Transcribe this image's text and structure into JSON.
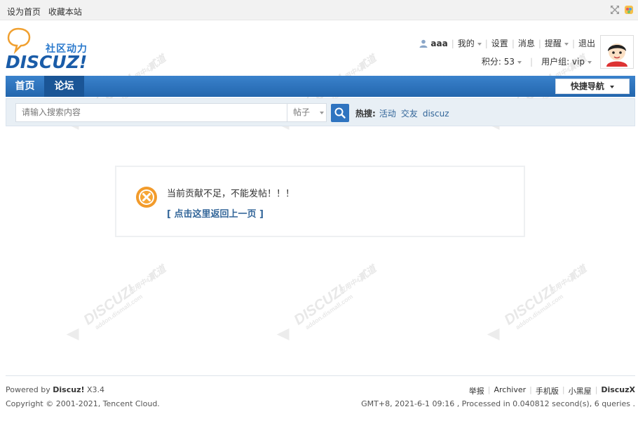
{
  "topbar": {
    "set_home": "设为首页",
    "bookmark": "收藏本站"
  },
  "logo": {
    "slogan": "社区动力",
    "word": "DISCUZ!"
  },
  "user_nav": {
    "username": "aaa",
    "my": "我的",
    "settings": "设置",
    "messages": "消息",
    "reminders": "提醒",
    "logout": "退出"
  },
  "user_info": {
    "points_label": "积分: 53",
    "group_label": "用户组: vip"
  },
  "nav": {
    "home": "首页",
    "forum": "论坛",
    "quick_nav": "快捷导航"
  },
  "search": {
    "placeholder": "请输入搜索内容",
    "type": "帖子",
    "hot_label": "热搜:",
    "hot_keywords": [
      "活动",
      "交友",
      "discuz"
    ]
  },
  "message": {
    "text": "当前贡献不足，不能发帖！！！",
    "back_link": "[ 点击这里返回上一页 ]"
  },
  "footer": {
    "powered_prefix": "Powered by",
    "powered_name": "Discuz!",
    "version": "X3.4",
    "copyright": "Copyright © 2001-2021, Tencent Cloud.",
    "links": [
      "举报",
      "Archiver",
      "手机版",
      "小黑屋",
      "DiscuzX"
    ],
    "server_info": "GMT+8, 2021-6-1 09:16 , Processed in 0.040812 second(s), 6 queries ."
  },
  "colors": {
    "nav_blue": "#2b6fb7",
    "active_tab": "#1a5596",
    "link": "#336699",
    "error_orange": "#f29b2b"
  }
}
